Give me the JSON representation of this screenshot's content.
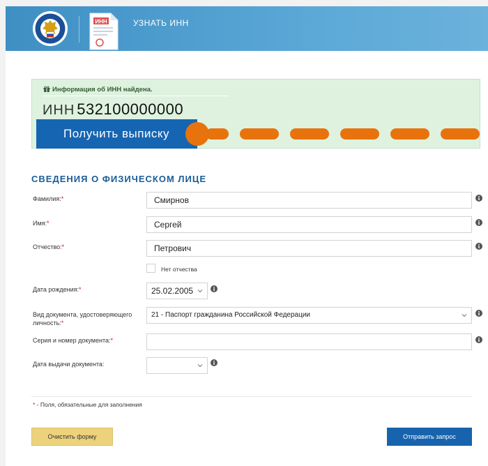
{
  "header": {
    "service_title": "УЗНАТЬ ИНН",
    "service_icon_text": "ИНН"
  },
  "result": {
    "message": "Информация об ИНН найдена.",
    "inn_label": "ИНН",
    "inn_value": "532100000000",
    "extract_button": "Получить выписку"
  },
  "section": {
    "title": "СВЕДЕНИЯ О ФИЗИЧЕСКОМ ЛИЦЕ"
  },
  "form": {
    "required_mark": "*",
    "surname": {
      "label": "Фамилия:",
      "value": "Смирнов"
    },
    "name": {
      "label": "Имя:",
      "value": "Сергей"
    },
    "patronymic": {
      "label": "Отчество:",
      "value": "Петрович"
    },
    "no_patronymic": {
      "label": "Нет отчества",
      "checked": false
    },
    "birth_date": {
      "label": "Дата рождения:",
      "value": "25.02.2005"
    },
    "doc_type": {
      "label_line1": "Вид документа, удостоверяющего",
      "label_line2": "личность:",
      "value": "21 - Паспорт гражданина Российской Федерации"
    },
    "doc_number": {
      "label": "Серия и номер документа:",
      "value": ""
    },
    "issue_date": {
      "label": "Дата выдачи документа:",
      "value": ""
    }
  },
  "footer": {
    "required_note": " - Поля, обязательные для заполнения",
    "clear_button": "Очистить форму",
    "submit_button": "Отправить запрос"
  },
  "colors": {
    "header_blue": "#4c9ccf",
    "success_bg": "#def2df",
    "primary_blue": "#1665b2",
    "annotation_orange": "#e8730c",
    "clear_yellow": "#edd27c",
    "required_red": "#d21b1b",
    "title_blue": "#1a5c98"
  }
}
